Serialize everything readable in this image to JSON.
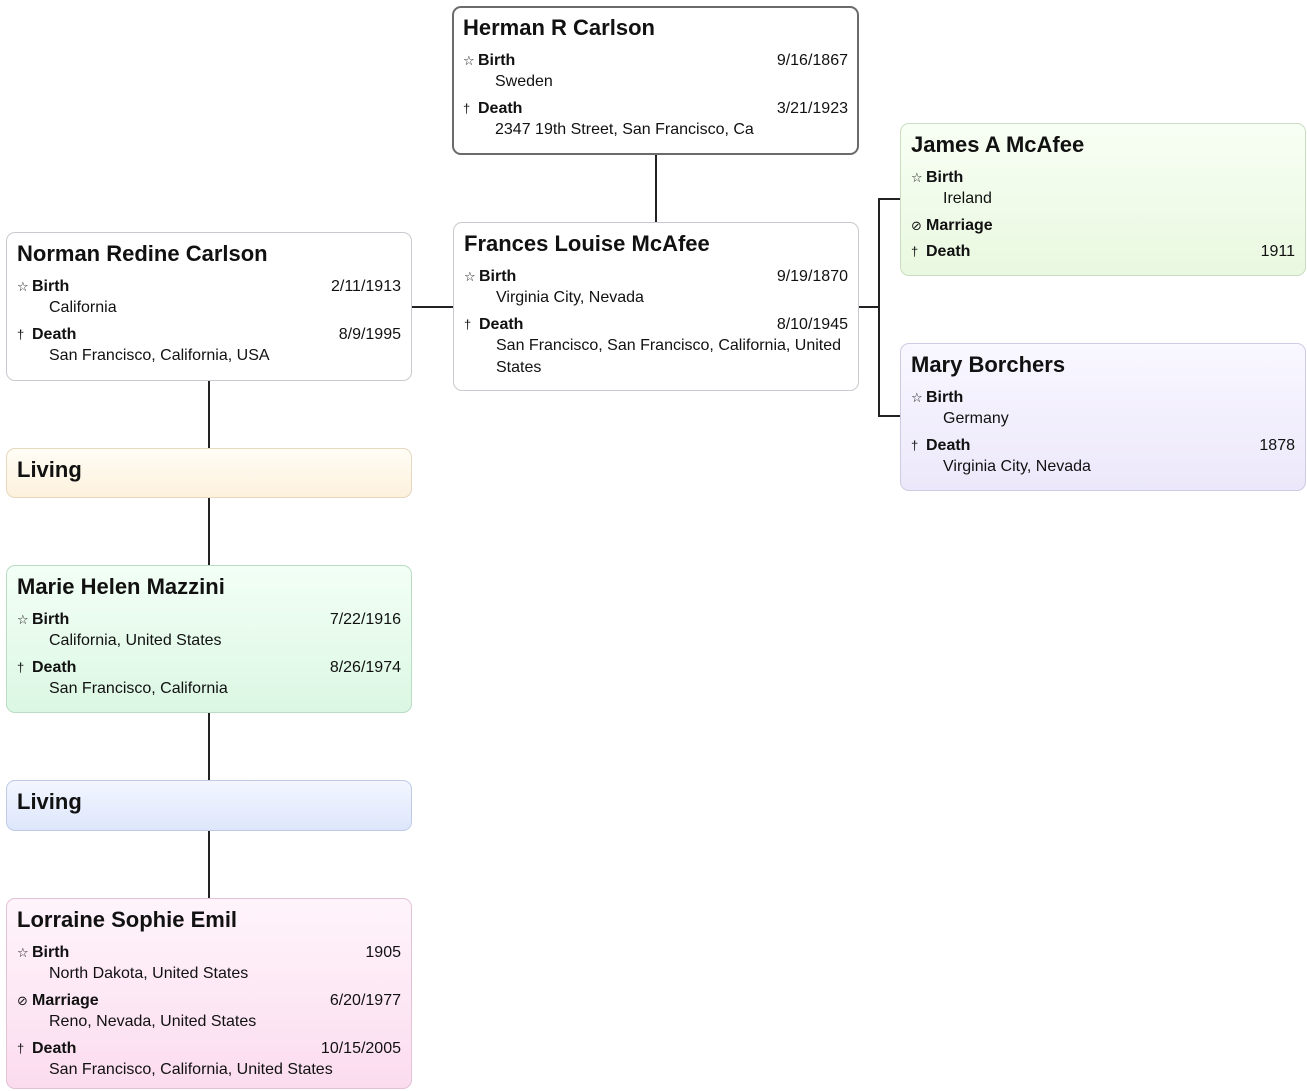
{
  "people": {
    "herman": {
      "name": "Herman R Carlson",
      "events": [
        {
          "label": "Birth",
          "icon": "☆",
          "date": "9/16/1867",
          "place": "Sweden"
        },
        {
          "label": "Death",
          "icon": "†",
          "date": "3/21/1923",
          "place": "2347 19th Street, San Francisco, Ca"
        }
      ]
    },
    "frances": {
      "name": "Frances Louise McAfee",
      "events": [
        {
          "label": "Birth",
          "icon": "☆",
          "date": "9/19/1870",
          "place": "Virginia City, Nevada"
        },
        {
          "label": "Death",
          "icon": "†",
          "date": "8/10/1945",
          "place": "San Francisco, San Francisco, California, United States"
        }
      ]
    },
    "james": {
      "name": "James A McAfee",
      "events": [
        {
          "label": "Birth",
          "icon": "☆",
          "date": "",
          "place": "Ireland"
        },
        {
          "label": "Marriage",
          "icon": "⊘",
          "date": "",
          "place": ""
        },
        {
          "label": "Death",
          "icon": "†",
          "date": "1911",
          "place": ""
        }
      ]
    },
    "mary": {
      "name": "Mary Borchers",
      "events": [
        {
          "label": "Birth",
          "icon": "☆",
          "date": "",
          "place": "Germany"
        },
        {
          "label": "Death",
          "icon": "†",
          "date": "1878",
          "place": "Virginia City, Nevada"
        }
      ]
    },
    "norman": {
      "name": "Norman Redine Carlson",
      "events": [
        {
          "label": "Birth",
          "icon": "☆",
          "date": "2/11/1913",
          "place": "California"
        },
        {
          "label": "Death",
          "icon": "†",
          "date": "8/9/1995",
          "place": "San Francisco, California, USA"
        }
      ]
    },
    "living1": {
      "name": "Living"
    },
    "marie": {
      "name": "Marie Helen Mazzini",
      "events": [
        {
          "label": "Birth",
          "icon": "☆",
          "date": "7/22/1916",
          "place": "California, United States"
        },
        {
          "label": "Death",
          "icon": "†",
          "date": "8/26/1974",
          "place": "San Francisco, California"
        }
      ]
    },
    "living2": {
      "name": "Living"
    },
    "lorraine": {
      "name": "Lorraine Sophie Emil",
      "events": [
        {
          "label": "Birth",
          "icon": "☆",
          "date": "1905",
          "place": "North Dakota, United States"
        },
        {
          "label": "Marriage",
          "icon": "⊘",
          "date": "6/20/1977",
          "place": "Reno, Nevada, United States"
        },
        {
          "label": "Death",
          "icon": "†",
          "date": "10/15/2005",
          "place": "San Francisco, California, United States"
        }
      ]
    }
  }
}
